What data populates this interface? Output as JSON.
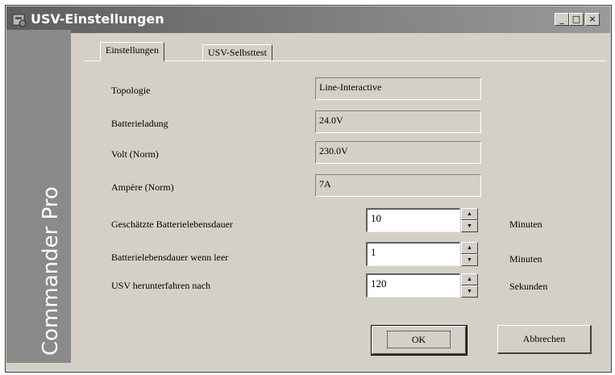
{
  "window": {
    "title": "USV-Einstellungen",
    "controls": {
      "minimize": "_",
      "maximize": "□",
      "close": "×"
    }
  },
  "sidebar": {
    "text": "Commander Pro"
  },
  "tabs": [
    {
      "label": "Einstellungen",
      "active": true
    },
    {
      "label": "USV-Selbsttest",
      "active": false
    }
  ],
  "info": {
    "topology_label": "Topologie",
    "topology_value": "Line-Interactive",
    "battery_label": "Batterieladung",
    "battery_value": "24.0V",
    "volt_label": "Volt (Norm)",
    "volt_value": "230.0V",
    "ampere_label": "Ampère (Norm)",
    "ampere_value": "7A"
  },
  "settings": {
    "runtime_label": "Geschätzte Batterielebensdauer",
    "runtime_value": "10",
    "runtime_unit": "Minuten",
    "empty_label": "Batterielebensdauer wenn leer",
    "empty_value": "1",
    "empty_unit": "Minuten",
    "shutdown_label": "USV herunterfahren nach",
    "shutdown_value": "120",
    "shutdown_unit": "Sekunden"
  },
  "buttons": {
    "ok": "OK",
    "cancel": "Abbrechen"
  },
  "icons": {
    "spin_up": "▲",
    "spin_down": "▼"
  }
}
